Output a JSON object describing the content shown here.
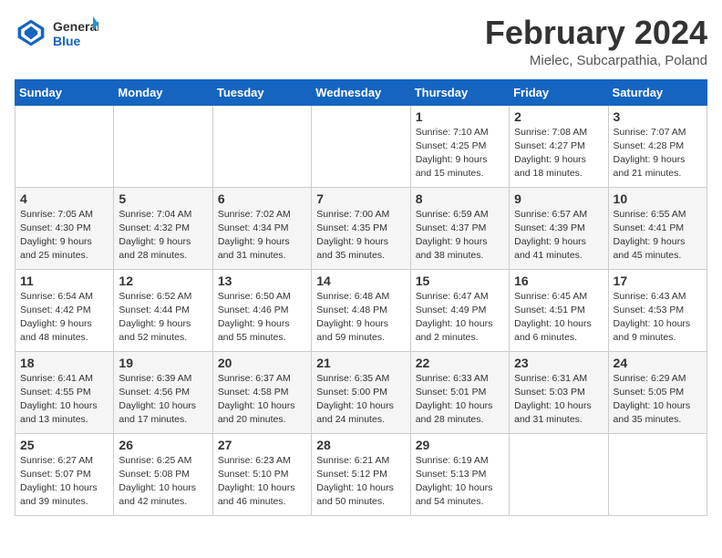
{
  "logo": {
    "general": "General",
    "blue": "Blue"
  },
  "header": {
    "title": "February 2024",
    "location": "Mielec, Subcarpathia, Poland"
  },
  "weekdays": [
    "Sunday",
    "Monday",
    "Tuesday",
    "Wednesday",
    "Thursday",
    "Friday",
    "Saturday"
  ],
  "weeks": [
    [
      {
        "day": "",
        "info": ""
      },
      {
        "day": "",
        "info": ""
      },
      {
        "day": "",
        "info": ""
      },
      {
        "day": "",
        "info": ""
      },
      {
        "day": "1",
        "info": "Sunrise: 7:10 AM\nSunset: 4:25 PM\nDaylight: 9 hours\nand 15 minutes."
      },
      {
        "day": "2",
        "info": "Sunrise: 7:08 AM\nSunset: 4:27 PM\nDaylight: 9 hours\nand 18 minutes."
      },
      {
        "day": "3",
        "info": "Sunrise: 7:07 AM\nSunset: 4:28 PM\nDaylight: 9 hours\nand 21 minutes."
      }
    ],
    [
      {
        "day": "4",
        "info": "Sunrise: 7:05 AM\nSunset: 4:30 PM\nDaylight: 9 hours\nand 25 minutes."
      },
      {
        "day": "5",
        "info": "Sunrise: 7:04 AM\nSunset: 4:32 PM\nDaylight: 9 hours\nand 28 minutes."
      },
      {
        "day": "6",
        "info": "Sunrise: 7:02 AM\nSunset: 4:34 PM\nDaylight: 9 hours\nand 31 minutes."
      },
      {
        "day": "7",
        "info": "Sunrise: 7:00 AM\nSunset: 4:35 PM\nDaylight: 9 hours\nand 35 minutes."
      },
      {
        "day": "8",
        "info": "Sunrise: 6:59 AM\nSunset: 4:37 PM\nDaylight: 9 hours\nand 38 minutes."
      },
      {
        "day": "9",
        "info": "Sunrise: 6:57 AM\nSunset: 4:39 PM\nDaylight: 9 hours\nand 41 minutes."
      },
      {
        "day": "10",
        "info": "Sunrise: 6:55 AM\nSunset: 4:41 PM\nDaylight: 9 hours\nand 45 minutes."
      }
    ],
    [
      {
        "day": "11",
        "info": "Sunrise: 6:54 AM\nSunset: 4:42 PM\nDaylight: 9 hours\nand 48 minutes."
      },
      {
        "day": "12",
        "info": "Sunrise: 6:52 AM\nSunset: 4:44 PM\nDaylight: 9 hours\nand 52 minutes."
      },
      {
        "day": "13",
        "info": "Sunrise: 6:50 AM\nSunset: 4:46 PM\nDaylight: 9 hours\nand 55 minutes."
      },
      {
        "day": "14",
        "info": "Sunrise: 6:48 AM\nSunset: 4:48 PM\nDaylight: 9 hours\nand 59 minutes."
      },
      {
        "day": "15",
        "info": "Sunrise: 6:47 AM\nSunset: 4:49 PM\nDaylight: 10 hours\nand 2 minutes."
      },
      {
        "day": "16",
        "info": "Sunrise: 6:45 AM\nSunset: 4:51 PM\nDaylight: 10 hours\nand 6 minutes."
      },
      {
        "day": "17",
        "info": "Sunrise: 6:43 AM\nSunset: 4:53 PM\nDaylight: 10 hours\nand 9 minutes."
      }
    ],
    [
      {
        "day": "18",
        "info": "Sunrise: 6:41 AM\nSunset: 4:55 PM\nDaylight: 10 hours\nand 13 minutes."
      },
      {
        "day": "19",
        "info": "Sunrise: 6:39 AM\nSunset: 4:56 PM\nDaylight: 10 hours\nand 17 minutes."
      },
      {
        "day": "20",
        "info": "Sunrise: 6:37 AM\nSunset: 4:58 PM\nDaylight: 10 hours\nand 20 minutes."
      },
      {
        "day": "21",
        "info": "Sunrise: 6:35 AM\nSunset: 5:00 PM\nDaylight: 10 hours\nand 24 minutes."
      },
      {
        "day": "22",
        "info": "Sunrise: 6:33 AM\nSunset: 5:01 PM\nDaylight: 10 hours\nand 28 minutes."
      },
      {
        "day": "23",
        "info": "Sunrise: 6:31 AM\nSunset: 5:03 PM\nDaylight: 10 hours\nand 31 minutes."
      },
      {
        "day": "24",
        "info": "Sunrise: 6:29 AM\nSunset: 5:05 PM\nDaylight: 10 hours\nand 35 minutes."
      }
    ],
    [
      {
        "day": "25",
        "info": "Sunrise: 6:27 AM\nSunset: 5:07 PM\nDaylight: 10 hours\nand 39 minutes."
      },
      {
        "day": "26",
        "info": "Sunrise: 6:25 AM\nSunset: 5:08 PM\nDaylight: 10 hours\nand 42 minutes."
      },
      {
        "day": "27",
        "info": "Sunrise: 6:23 AM\nSunset: 5:10 PM\nDaylight: 10 hours\nand 46 minutes."
      },
      {
        "day": "28",
        "info": "Sunrise: 6:21 AM\nSunset: 5:12 PM\nDaylight: 10 hours\nand 50 minutes."
      },
      {
        "day": "29",
        "info": "Sunrise: 6:19 AM\nSunset: 5:13 PM\nDaylight: 10 hours\nand 54 minutes."
      },
      {
        "day": "",
        "info": ""
      },
      {
        "day": "",
        "info": ""
      }
    ]
  ]
}
